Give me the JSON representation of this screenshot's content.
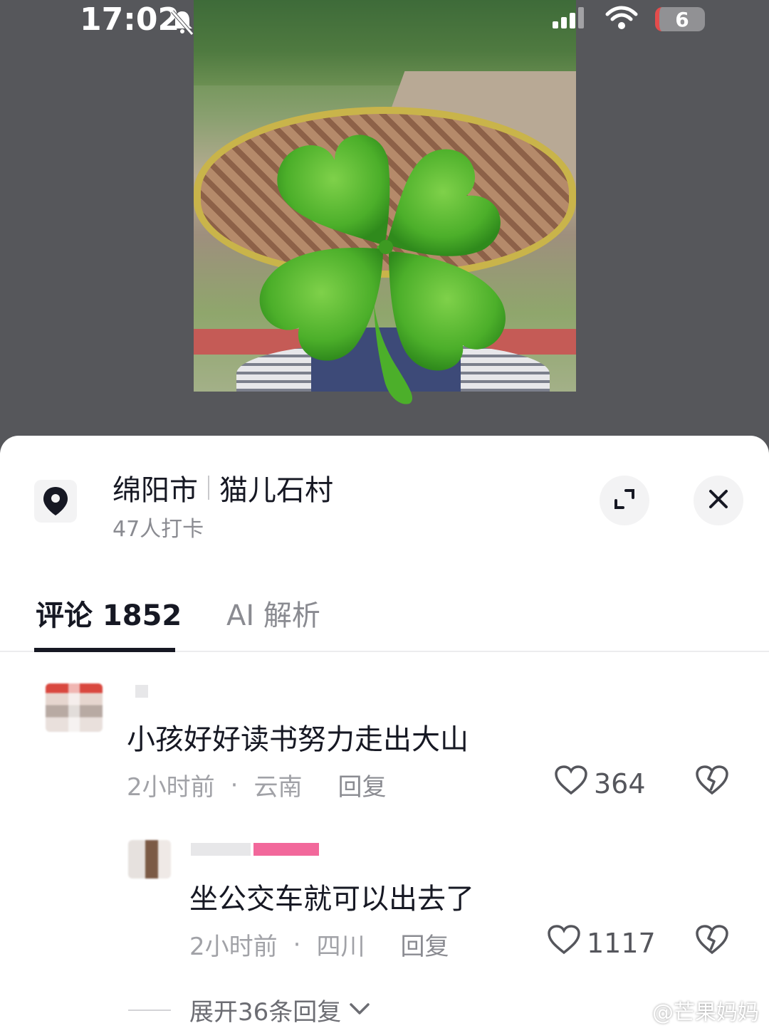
{
  "status_bar": {
    "time": "17:02",
    "battery": "6"
  },
  "location": {
    "city": "绵阳市",
    "place": "猫儿石村",
    "checkins": "47人打卡"
  },
  "tabs": [
    {
      "label": "评论 1852"
    },
    {
      "label": "AI 解析"
    }
  ],
  "comments": [
    {
      "text": "小孩好好读书努力走出大山",
      "time": "2小时前",
      "region": "云南",
      "reply": "回复",
      "likes": "364"
    },
    {
      "text": "坐公交车就可以出去了",
      "time": "2小时前",
      "region": "四川",
      "reply": "回复",
      "likes": "1117"
    }
  ],
  "expand_replies": "展开36条回复",
  "watermark": "@芒果妈妈",
  "colors": {
    "sheet_bg": "#ffffff",
    "primary_text": "#161823",
    "secondary_text": "#8a8b91",
    "clover_green": "#4caf2a"
  }
}
